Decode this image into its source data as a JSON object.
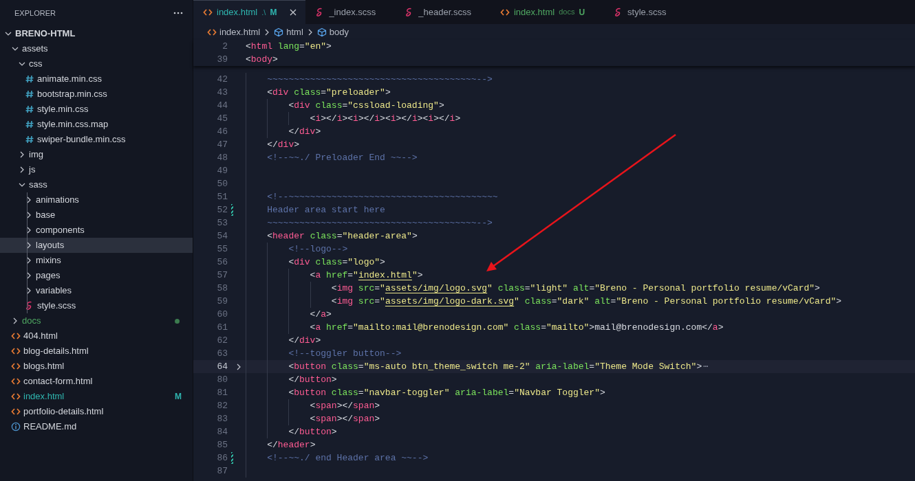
{
  "explorer": {
    "title": "EXPLORER"
  },
  "tree": {
    "label": "BRENO-HTML",
    "kind": "root",
    "expanded": true,
    "selected": false,
    "children": [
      {
        "label": "assets",
        "kind": "folder",
        "expanded": true,
        "selected": false,
        "children": [
          {
            "label": "css",
            "kind": "folder",
            "expanded": true,
            "selected": false,
            "children": [
              {
                "label": "animate.min.css",
                "kind": "css",
                "selected": false
              },
              {
                "label": "bootstrap.min.css",
                "kind": "css",
                "selected": false
              },
              {
                "label": "style.min.css",
                "kind": "css",
                "selected": false
              },
              {
                "label": "style.min.css.map",
                "kind": "css",
                "selected": false
              },
              {
                "label": "swiper-bundle.min.css",
                "kind": "css",
                "selected": false
              }
            ]
          },
          {
            "label": "img",
            "kind": "folder",
            "expanded": false,
            "selected": false
          },
          {
            "label": "js",
            "kind": "folder",
            "expanded": false,
            "selected": false
          },
          {
            "label": "sass",
            "kind": "folder",
            "expanded": true,
            "selected": false,
            "children": [
              {
                "label": "animations",
                "kind": "folder",
                "expanded": false,
                "selected": false
              },
              {
                "label": "base",
                "kind": "folder",
                "expanded": false,
                "selected": false
              },
              {
                "label": "components",
                "kind": "folder",
                "expanded": false,
                "selected": false
              },
              {
                "label": "layouts",
                "kind": "folder",
                "expanded": false,
                "selected": true
              },
              {
                "label": "mixins",
                "kind": "folder",
                "expanded": false,
                "selected": false
              },
              {
                "label": "pages",
                "kind": "folder",
                "expanded": false,
                "selected": false
              },
              {
                "label": "variables",
                "kind": "folder",
                "expanded": false,
                "selected": false
              },
              {
                "label": "style.scss",
                "kind": "scss",
                "selected": false
              }
            ]
          }
        ]
      },
      {
        "label": "docs",
        "kind": "folder",
        "expanded": false,
        "selected": false,
        "color": "#4fa862"
      },
      {
        "label": "404.html",
        "kind": "html",
        "selected": false
      },
      {
        "label": "blog-details.html",
        "kind": "html",
        "selected": false
      },
      {
        "label": "blogs.html",
        "kind": "html",
        "selected": false
      },
      {
        "label": "contact-form.html",
        "kind": "html",
        "selected": false
      },
      {
        "label": "index.html",
        "kind": "html",
        "selected": false,
        "color": "#2fb6b0",
        "badge": "M"
      },
      {
        "label": "portfolio-details.html",
        "kind": "html",
        "selected": false
      },
      {
        "label": "README.md",
        "kind": "info",
        "selected": false
      }
    ]
  },
  "tabs": [
    {
      "label": "index.html",
      "kind": "html",
      "selected": true,
      "detail": ".\\",
      "badge": "M",
      "color": "#2fb6b0"
    },
    {
      "label": "_index.scss",
      "kind": "scss",
      "selected": false
    },
    {
      "label": "_header.scss",
      "kind": "scss",
      "selected": false
    },
    {
      "label": "index.html",
      "kind": "html",
      "selected": false,
      "detail": "docs",
      "badge": "U",
      "color": "#4fa862"
    },
    {
      "label": "style.scss",
      "kind": "scss",
      "selected": false
    }
  ],
  "breadcrumbs": [
    {
      "label": "index.html",
      "kind": "html"
    },
    {
      "label": "html",
      "kind": "element"
    },
    {
      "label": "body",
      "kind": "element"
    }
  ],
  "sticky_lines": [
    {
      "number": "2",
      "tokens": [
        {
          "kind": "punct",
          "text": "<"
        },
        {
          "kind": "tag",
          "text": "html"
        },
        {
          "kind": "attr",
          "text": " lang"
        },
        {
          "kind": "punct",
          "text": "="
        },
        {
          "kind": "string",
          "text": "\"en\""
        },
        {
          "kind": "punct",
          "text": ">"
        }
      ]
    },
    {
      "number": "39",
      "tokens": [
        {
          "kind": "punct",
          "text": "<"
        },
        {
          "kind": "tag",
          "text": "body"
        },
        {
          "kind": "punct",
          "text": ">"
        }
      ]
    }
  ],
  "lines": [
    {
      "number": "42",
      "tokens": [
        {
          "kind": "comment",
          "text": "    ~~~~~~~~~~~~~~~~~~~~~~~~~~~~~~~~~~~~~~~-->"
        }
      ]
    },
    {
      "number": "43",
      "tokens": [
        {
          "kind": "punct",
          "text": "    <"
        },
        {
          "kind": "tag",
          "text": "div"
        },
        {
          "kind": "attr",
          "text": " class"
        },
        {
          "kind": "punct",
          "text": "="
        },
        {
          "kind": "string",
          "text": "\"preloader\""
        },
        {
          "kind": "punct",
          "text": ">"
        }
      ]
    },
    {
      "number": "44",
      "tokens": [
        {
          "kind": "punct",
          "text": "        <"
        },
        {
          "kind": "tag",
          "text": "div"
        },
        {
          "kind": "attr",
          "text": " class"
        },
        {
          "kind": "punct",
          "text": "="
        },
        {
          "kind": "string",
          "text": "\"cssload-loading\""
        },
        {
          "kind": "punct",
          "text": ">"
        }
      ]
    },
    {
      "number": "45",
      "tokens": [
        {
          "kind": "punct",
          "text": "            <"
        },
        {
          "kind": "tag",
          "text": "i"
        },
        {
          "kind": "punct",
          "text": "></"
        },
        {
          "kind": "tag",
          "text": "i"
        },
        {
          "kind": "punct",
          "text": "><"
        },
        {
          "kind": "tag",
          "text": "i"
        },
        {
          "kind": "punct",
          "text": "></"
        },
        {
          "kind": "tag",
          "text": "i"
        },
        {
          "kind": "punct",
          "text": "><"
        },
        {
          "kind": "tag",
          "text": "i"
        },
        {
          "kind": "punct",
          "text": "></"
        },
        {
          "kind": "tag",
          "text": "i"
        },
        {
          "kind": "punct",
          "text": "><"
        },
        {
          "kind": "tag",
          "text": "i"
        },
        {
          "kind": "punct",
          "text": "></"
        },
        {
          "kind": "tag",
          "text": "i"
        },
        {
          "kind": "punct",
          "text": ">"
        }
      ]
    },
    {
      "number": "46",
      "tokens": [
        {
          "kind": "punct",
          "text": "        </"
        },
        {
          "kind": "tag",
          "text": "div"
        },
        {
          "kind": "punct",
          "text": ">"
        }
      ]
    },
    {
      "number": "47",
      "tokens": [
        {
          "kind": "punct",
          "text": "    </"
        },
        {
          "kind": "tag",
          "text": "div"
        },
        {
          "kind": "punct",
          "text": ">"
        }
      ]
    },
    {
      "number": "48",
      "tokens": [
        {
          "kind": "comment",
          "text": "    <!--~~./ Preloader End ~~-->"
        }
      ]
    },
    {
      "number": "49"
    },
    {
      "number": "50"
    },
    {
      "number": "51",
      "tokens": [
        {
          "kind": "comment",
          "text": "    <!--~~~~~~~~~~~~~~~~~~~~~~~~~~~~~~~~~~~~~~~"
        }
      ]
    },
    {
      "number": "52",
      "changed": true,
      "tokens": [
        {
          "kind": "comment",
          "text": "    Header area start here"
        }
      ]
    },
    {
      "number": "53",
      "tokens": [
        {
          "kind": "comment",
          "text": "    ~~~~~~~~~~~~~~~~~~~~~~~~~~~~~~~~~~~~~~~-->"
        }
      ]
    },
    {
      "number": "54",
      "tokens": [
        {
          "kind": "punct",
          "text": "    <"
        },
        {
          "kind": "tag",
          "text": "header"
        },
        {
          "kind": "attr",
          "text": " class"
        },
        {
          "kind": "punct",
          "text": "="
        },
        {
          "kind": "string",
          "text": "\"header-area\""
        },
        {
          "kind": "punct",
          "text": ">"
        }
      ]
    },
    {
      "number": "55",
      "tokens": [
        {
          "kind": "comment",
          "text": "        <!--logo-->"
        }
      ]
    },
    {
      "number": "56",
      "tokens": [
        {
          "kind": "punct",
          "text": "        <"
        },
        {
          "kind": "tag",
          "text": "div"
        },
        {
          "kind": "attr",
          "text": " class"
        },
        {
          "kind": "punct",
          "text": "="
        },
        {
          "kind": "string",
          "text": "\"logo\""
        },
        {
          "kind": "punct",
          "text": ">"
        }
      ]
    },
    {
      "number": "57",
      "tokens": [
        {
          "kind": "punct",
          "text": "            <"
        },
        {
          "kind": "tag",
          "text": "a"
        },
        {
          "kind": "attr",
          "text": " href"
        },
        {
          "kind": "punct",
          "text": "="
        },
        {
          "kind": "string",
          "text": "\""
        },
        {
          "kind": "link",
          "text": "index.html"
        },
        {
          "kind": "string",
          "text": "\""
        },
        {
          "kind": "punct",
          "text": ">"
        }
      ]
    },
    {
      "number": "58",
      "tokens": [
        {
          "kind": "punct",
          "text": "                <"
        },
        {
          "kind": "tag",
          "text": "img"
        },
        {
          "kind": "attr",
          "text": " src"
        },
        {
          "kind": "punct",
          "text": "="
        },
        {
          "kind": "string",
          "text": "\""
        },
        {
          "kind": "link",
          "text": "assets/img/logo.svg"
        },
        {
          "kind": "string",
          "text": "\""
        },
        {
          "kind": "attr",
          "text": " class"
        },
        {
          "kind": "punct",
          "text": "="
        },
        {
          "kind": "string",
          "text": "\"light\""
        },
        {
          "kind": "attr",
          "text": " alt"
        },
        {
          "kind": "punct",
          "text": "="
        },
        {
          "kind": "string",
          "text": "\"Breno - Personal portfolio resume/vCard\""
        },
        {
          "kind": "punct",
          "text": ">"
        }
      ]
    },
    {
      "number": "59",
      "tokens": [
        {
          "kind": "punct",
          "text": "                <"
        },
        {
          "kind": "tag",
          "text": "img"
        },
        {
          "kind": "attr",
          "text": " src"
        },
        {
          "kind": "punct",
          "text": "="
        },
        {
          "kind": "string",
          "text": "\""
        },
        {
          "kind": "link",
          "text": "assets/img/logo-dark.svg"
        },
        {
          "kind": "string",
          "text": "\""
        },
        {
          "kind": "attr",
          "text": " class"
        },
        {
          "kind": "punct",
          "text": "="
        },
        {
          "kind": "string",
          "text": "\"dark\""
        },
        {
          "kind": "attr",
          "text": " alt"
        },
        {
          "kind": "punct",
          "text": "="
        },
        {
          "kind": "string",
          "text": "\"Breno - Personal portfolio resume/vCard\""
        },
        {
          "kind": "punct",
          "text": ">"
        }
      ]
    },
    {
      "number": "60",
      "tokens": [
        {
          "kind": "punct",
          "text": "            </"
        },
        {
          "kind": "tag",
          "text": "a"
        },
        {
          "kind": "punct",
          "text": ">"
        }
      ]
    },
    {
      "number": "61",
      "tokens": [
        {
          "kind": "punct",
          "text": "            <"
        },
        {
          "kind": "tag",
          "text": "a"
        },
        {
          "kind": "attr",
          "text": " href"
        },
        {
          "kind": "punct",
          "text": "="
        },
        {
          "kind": "string",
          "text": "\"mailto:mail@brenodesign.com\""
        },
        {
          "kind": "attr",
          "text": " class"
        },
        {
          "kind": "punct",
          "text": "="
        },
        {
          "kind": "string",
          "text": "\"mailto\""
        },
        {
          "kind": "punct",
          "text": ">"
        },
        {
          "kind": "text",
          "text": "mail@brenodesign.com"
        },
        {
          "kind": "punct",
          "text": "</"
        },
        {
          "kind": "tag",
          "text": "a"
        },
        {
          "kind": "punct",
          "text": ">"
        }
      ]
    },
    {
      "number": "62",
      "tokens": [
        {
          "kind": "punct",
          "text": "        </"
        },
        {
          "kind": "tag",
          "text": "div"
        },
        {
          "kind": "punct",
          "text": ">"
        }
      ]
    },
    {
      "number": "63",
      "tokens": [
        {
          "kind": "comment",
          "text": "        <!--toggler button-->"
        }
      ]
    },
    {
      "number": "64",
      "folded": true,
      "current": true,
      "fold_marker": "⋯",
      "tokens": [
        {
          "kind": "punct",
          "text": "        <"
        },
        {
          "kind": "tag",
          "text": "button"
        },
        {
          "kind": "attr",
          "text": " class"
        },
        {
          "kind": "punct",
          "text": "="
        },
        {
          "kind": "string",
          "text": "\"ms-auto btn_theme_switch me-2\""
        },
        {
          "kind": "attr",
          "text": " aria-label"
        },
        {
          "kind": "punct",
          "text": "="
        },
        {
          "kind": "string",
          "text": "\"Theme Mode Switch\""
        },
        {
          "kind": "punct",
          "text": ">"
        }
      ]
    },
    {
      "number": "80",
      "tokens": [
        {
          "kind": "punct",
          "text": "        </"
        },
        {
          "kind": "tag",
          "text": "button"
        },
        {
          "kind": "punct",
          "text": ">"
        }
      ]
    },
    {
      "number": "81",
      "tokens": [
        {
          "kind": "punct",
          "text": "        <"
        },
        {
          "kind": "tag",
          "text": "button"
        },
        {
          "kind": "attr",
          "text": " class"
        },
        {
          "kind": "punct",
          "text": "="
        },
        {
          "kind": "string",
          "text": "\"navbar-toggler\""
        },
        {
          "kind": "attr",
          "text": " aria-label"
        },
        {
          "kind": "punct",
          "text": "="
        },
        {
          "kind": "string",
          "text": "\"Navbar Toggler\""
        },
        {
          "kind": "punct",
          "text": ">"
        }
      ]
    },
    {
      "number": "82",
      "tokens": [
        {
          "kind": "punct",
          "text": "            <"
        },
        {
          "kind": "tag",
          "text": "span"
        },
        {
          "kind": "punct",
          "text": "></"
        },
        {
          "kind": "tag",
          "text": "span"
        },
        {
          "kind": "punct",
          "text": ">"
        }
      ]
    },
    {
      "number": "83",
      "tokens": [
        {
          "kind": "punct",
          "text": "            <"
        },
        {
          "kind": "tag",
          "text": "span"
        },
        {
          "kind": "punct",
          "text": "></"
        },
        {
          "kind": "tag",
          "text": "span"
        },
        {
          "kind": "punct",
          "text": ">"
        }
      ]
    },
    {
      "number": "84",
      "tokens": [
        {
          "kind": "punct",
          "text": "        </"
        },
        {
          "kind": "tag",
          "text": "button"
        },
        {
          "kind": "punct",
          "text": ">"
        }
      ]
    },
    {
      "number": "85",
      "tokens": [
        {
          "kind": "punct",
          "text": "    </"
        },
        {
          "kind": "tag",
          "text": "header"
        },
        {
          "kind": "punct",
          "text": ">"
        }
      ]
    },
    {
      "number": "86",
      "changed": true,
      "tokens": [
        {
          "kind": "comment",
          "text": "    <!--~~./ end Header area ~~-->"
        }
      ]
    },
    {
      "number": "87"
    }
  ],
  "annotation": {
    "kind": "arrow"
  }
}
